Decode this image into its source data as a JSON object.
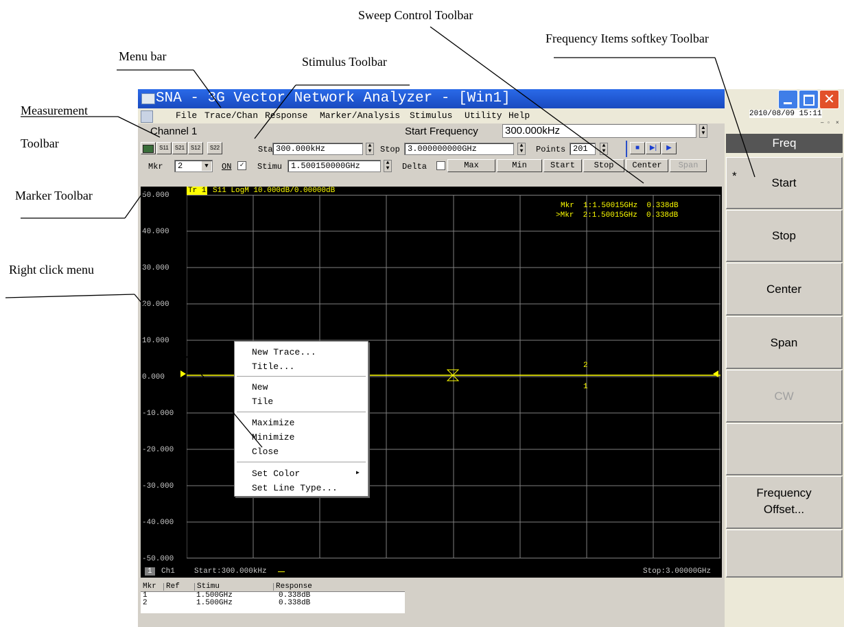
{
  "callouts": {
    "sweep_control": "Sweep Control Toolbar",
    "frequency_items": "Frequency Items softkey Toolbar",
    "menu_bar": "Menu bar",
    "stimulus": "Stimulus Toolbar",
    "measurement_line1": "Measurement",
    "measurement_line2": "Toolbar",
    "marker": "Marker Toolbar",
    "right_click": "Right click menu"
  },
  "window": {
    "title": "SNA - 3G Vector Network Analyzer - [Win1]",
    "datetime": "2010/08/09 15:11"
  },
  "menu": [
    "File",
    "Trace/Chan",
    "Response",
    "Marker/Analysis",
    "Stimulus",
    "Utility",
    "Help"
  ],
  "channel": {
    "label": "Channel 1",
    "entry_label": "Start Frequency",
    "entry_value": "300.000kHz"
  },
  "measurement_toolbar": [
    "S11",
    "S21",
    "S12",
    "S22"
  ],
  "stimulus_toolbar": {
    "start_label": "Start",
    "start_value": "300.000kHz",
    "stop_label": "Stop",
    "stop_value": "3.000000000GHz",
    "points_label": "Points",
    "points_value": "201"
  },
  "sweep_toolbar": {
    "buttons": [
      "stop-icon",
      "step-icon",
      "play-icon"
    ]
  },
  "marker_toolbar": {
    "mkr_label": "Mkr",
    "mkr_value": "2",
    "on_label": "ON",
    "stimu_label": "Stimu",
    "stimu_value": "1.500150000GHz",
    "delta_label": "Delta",
    "buttons": [
      "Max",
      "Min",
      "Start",
      "Stop",
      "Center",
      "Span"
    ]
  },
  "trace": {
    "tag": "Tr 1",
    "descriptor": "S11 LogM 10.000dB/0.00000dB",
    "color": "#ffff00"
  },
  "plot": {
    "y_ticks": [
      "50.000",
      "40.000",
      "30.000",
      "20.000",
      "10.000",
      "0.000",
      "-10.000",
      "-20.000",
      "-30.000",
      "-40.000",
      "-50.000"
    ],
    "marker_lines": [
      "Mkr  1:1.50015GHz  0.338dB",
      ">Mkr  2:1.50015GHz  0.338dB"
    ],
    "marker_labels": [
      "1",
      "2"
    ],
    "footer_ch_num": "1",
    "footer_ch": "Ch1",
    "footer_start": "Start:300.000kHz",
    "footer_stop": "Stop:3.00000GHz"
  },
  "context_menu": [
    "New Trace...",
    "Title...",
    "New",
    "Tile",
    "Maximize",
    "Minimize",
    "Close",
    "Set Color",
    "Set Line Type..."
  ],
  "marker_table": {
    "headers": [
      "Mkr",
      "Ref",
      "Stimu",
      "Response"
    ],
    "rows": [
      [
        "1",
        "",
        "1.500GHz",
        "0.338dB"
      ],
      [
        "2",
        "",
        "1.500GHz",
        "0.338dB"
      ]
    ]
  },
  "softkeys": {
    "header": "Freq",
    "active_mark": "*",
    "items": [
      "Start",
      "Stop",
      "Center",
      "Span",
      "CW",
      "",
      "Frequency",
      "Offset...",
      ""
    ]
  },
  "colors": {
    "titlebar": "#1f56d0",
    "plot_bg": "#000000",
    "trace": "#ffff00",
    "grid": "#808080",
    "softkey_header": "#555555"
  }
}
